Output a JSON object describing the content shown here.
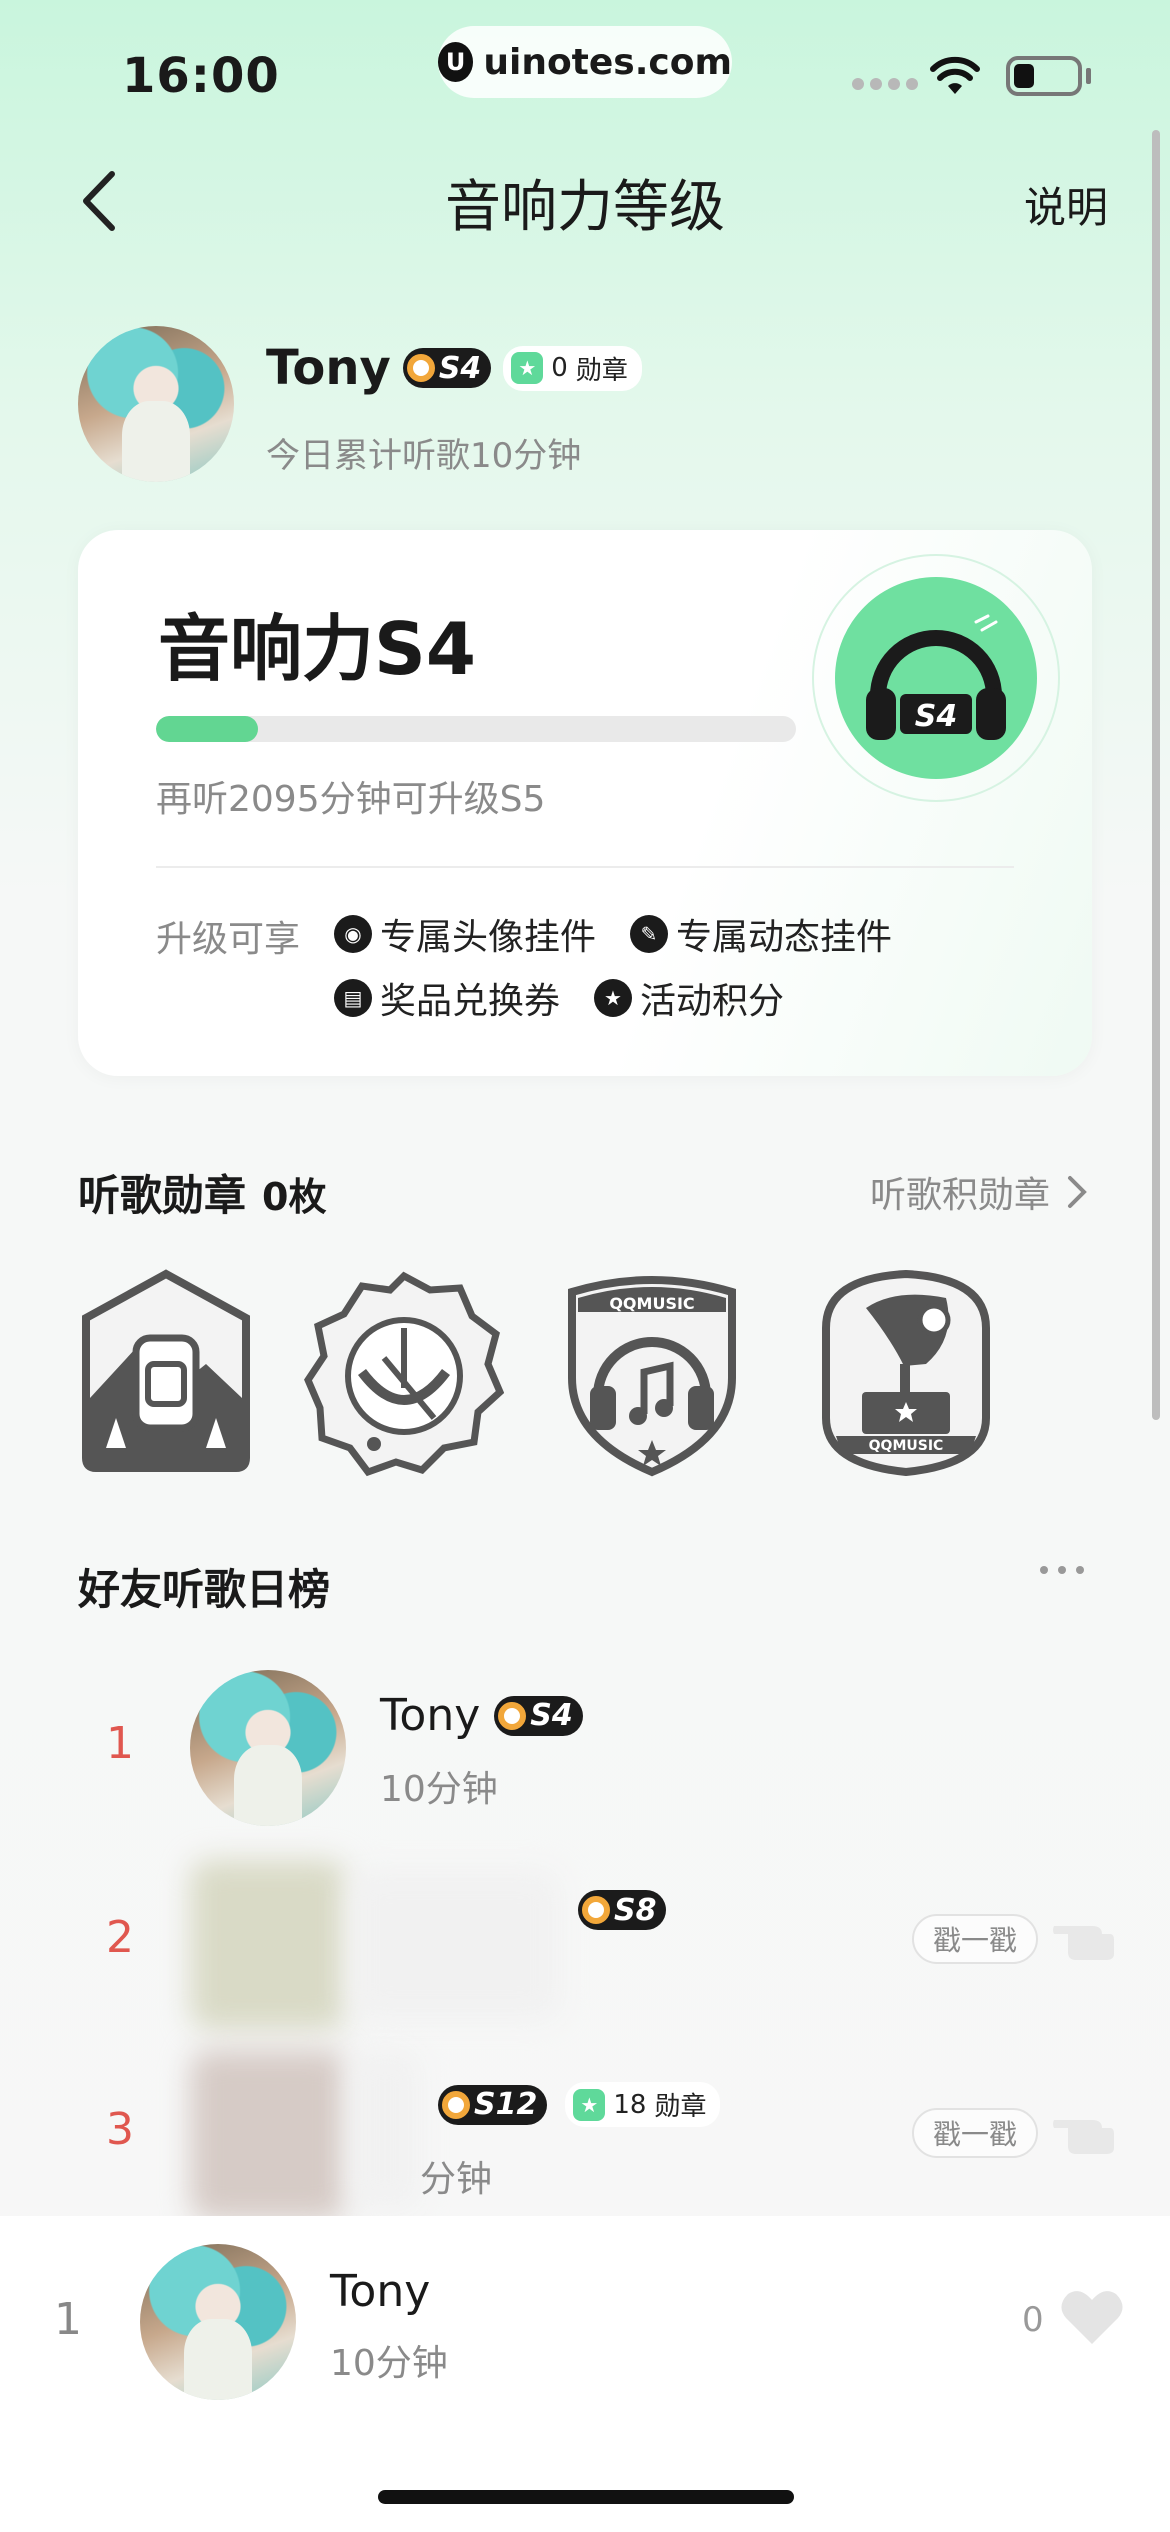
{
  "status_bar": {
    "time": "16:00",
    "url": "uinotes.com"
  },
  "nav": {
    "title": "音响力等级",
    "explain": "说明"
  },
  "profile": {
    "name": "Tony",
    "level_badge": "S4",
    "medal_count": "0",
    "medal_unit": "勋章",
    "today": "今日累计听歌10分钟"
  },
  "level_card": {
    "title": "音响力S4",
    "progress": 0.16,
    "progress_text": "再听2095分钟可升级S5",
    "upgrade_label": "升级可享",
    "perks": [
      {
        "label": "专属头像挂件",
        "icon": "avatar-pendant-icon"
      },
      {
        "label": "专属动态挂件",
        "icon": "post-pendant-icon"
      },
      {
        "label": "奖品兑换券",
        "icon": "coupon-icon"
      },
      {
        "label": "活动积分",
        "icon": "star-points-icon"
      }
    ],
    "emblem_text": "S4"
  },
  "medals": {
    "title": "听歌勋章",
    "count": "0枚",
    "link": "听歌积勋章",
    "items": [
      "backpack-medal-icon",
      "bow-medal-icon",
      "headphones-shield-medal-icon",
      "gramophone-medal-icon"
    ],
    "qq_text": "QQMUSIC"
  },
  "friends": {
    "title": "好友听歌日榜",
    "rows": [
      {
        "rank": "1",
        "name": "Tony",
        "badge": "S4",
        "sub": "10分钟"
      },
      {
        "rank": "2",
        "badge": "S8",
        "poke": "戳一戳"
      },
      {
        "rank": "3",
        "badge": "S12",
        "medal_count": "18",
        "medal_unit": "勋章",
        "sub": "分钟",
        "poke": "戳一戳"
      }
    ]
  },
  "me": {
    "rank": "1",
    "name": "Tony",
    "sub": "10分钟",
    "likes": "0"
  },
  "colors": {
    "accent": "#62d692",
    "rank": "#e0574f",
    "badge_bg": "#1b1b1b"
  }
}
